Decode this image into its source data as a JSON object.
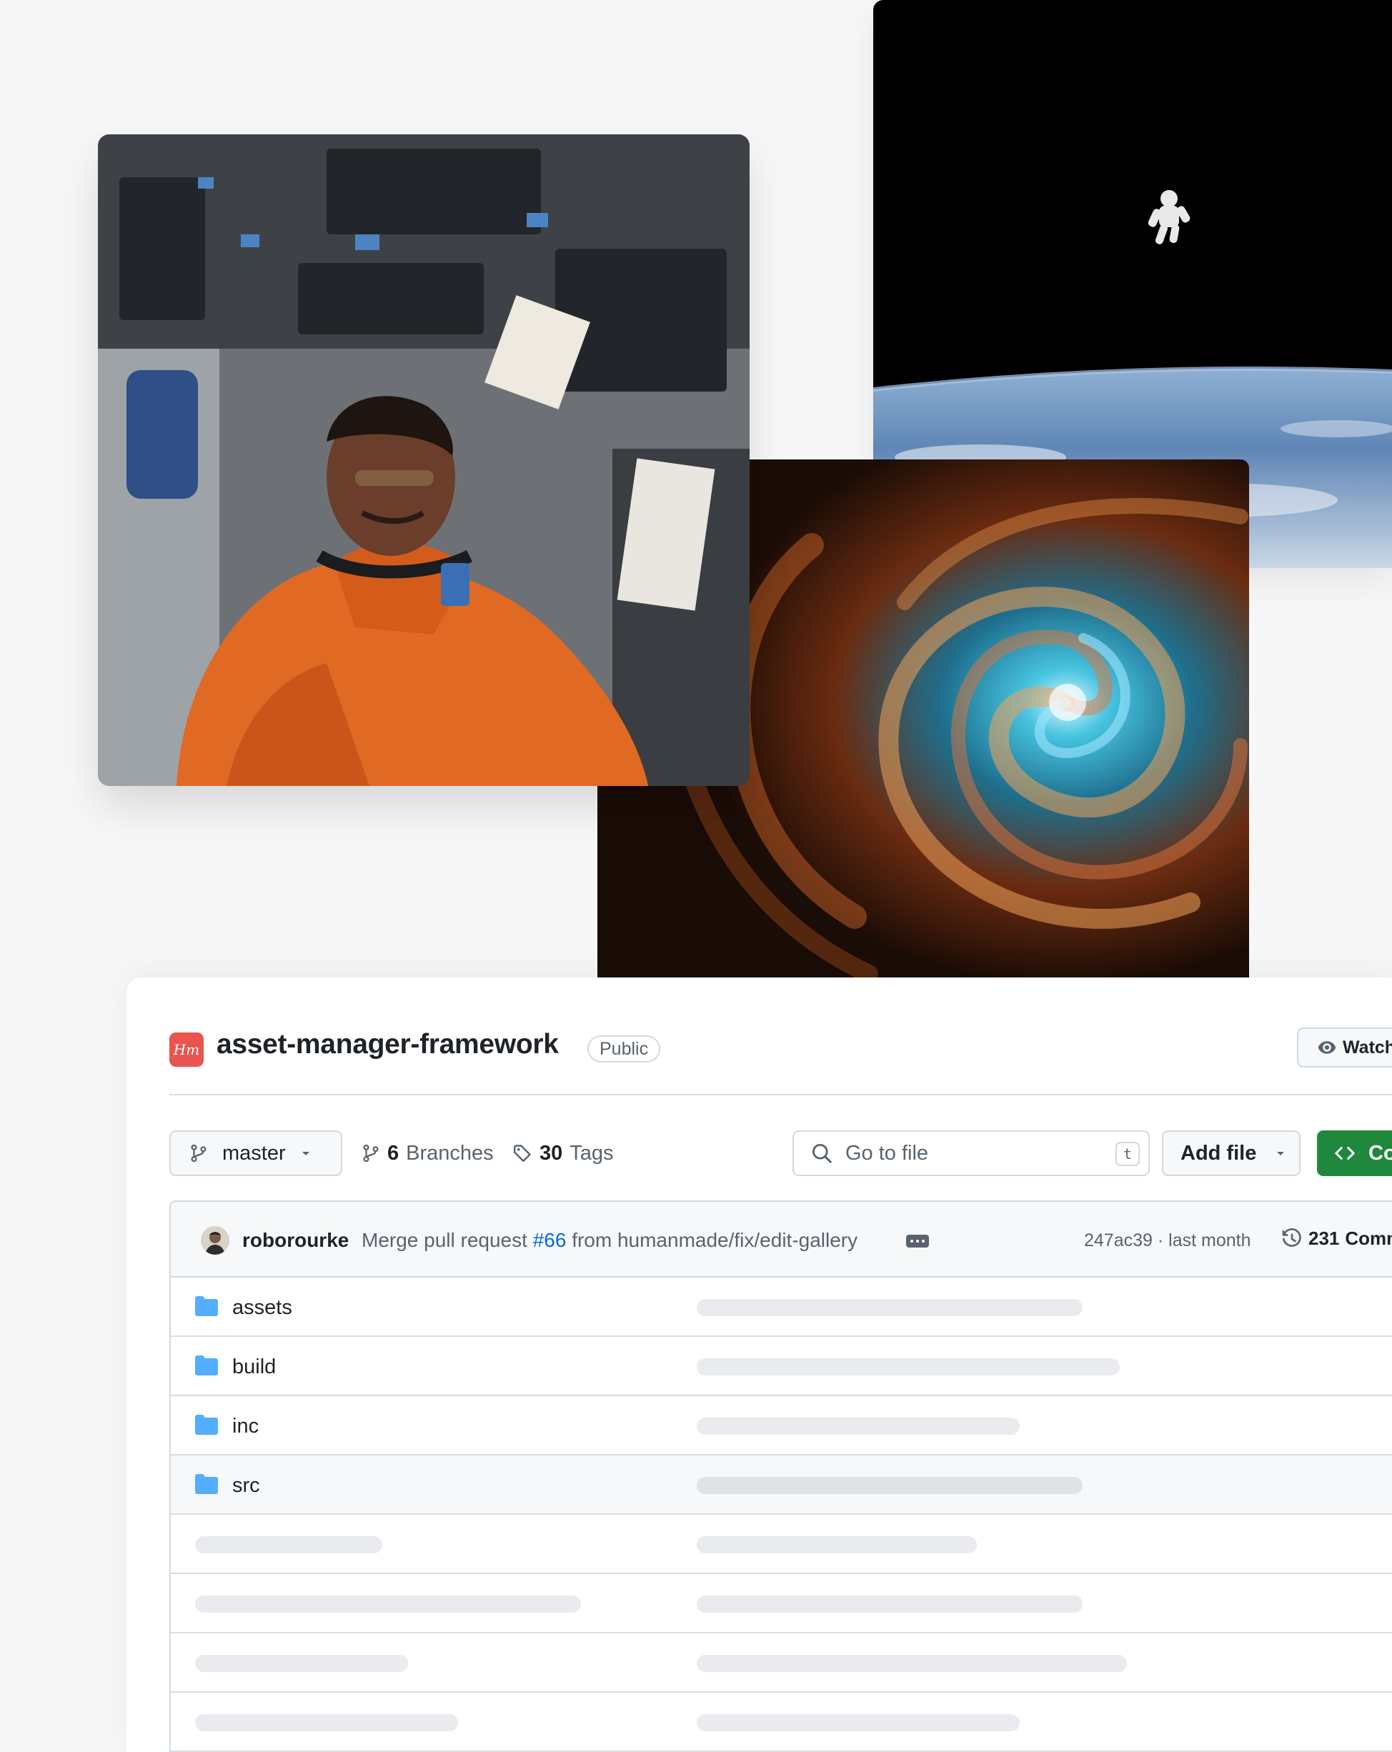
{
  "photos": {
    "astronaut": "astronaut-in-shuttle-cockpit",
    "earth": "astronaut-floating-above-earth",
    "galaxy": "spiral-galaxy"
  },
  "repo": {
    "logo_icon": "humanmade-logo-icon",
    "logo_text": "Hm",
    "name": "asset-manager-framework",
    "visibility": "Public",
    "watch_label": "Watch"
  },
  "toolbar": {
    "branch": "master",
    "branches_count": "6",
    "branches_label": "Branches",
    "tags_count": "30",
    "tags_label": "Tags",
    "search_placeholder": "Go to file",
    "search_shortcut": "t",
    "add_file_label": "Add file",
    "code_label": "Code"
  },
  "commit": {
    "author": "roborourke",
    "message_prefix": "Merge pull request",
    "pr_number": "#66",
    "message_suffix": "from humanmade/fix/edit-gallery",
    "hash": "247ac39",
    "separator": "·",
    "time": "last month",
    "count_number": "231",
    "count_label": "Commits"
  },
  "files": [
    {
      "name": "assets",
      "type": "folder"
    },
    {
      "name": "build",
      "type": "folder"
    },
    {
      "name": "inc",
      "type": "folder"
    },
    {
      "name": "src",
      "type": "folder"
    }
  ],
  "colors": {
    "accent_green": "#1f883d",
    "link_blue": "#0969da",
    "folder_blue": "#54aeff",
    "logo_red": "#e8554e"
  }
}
